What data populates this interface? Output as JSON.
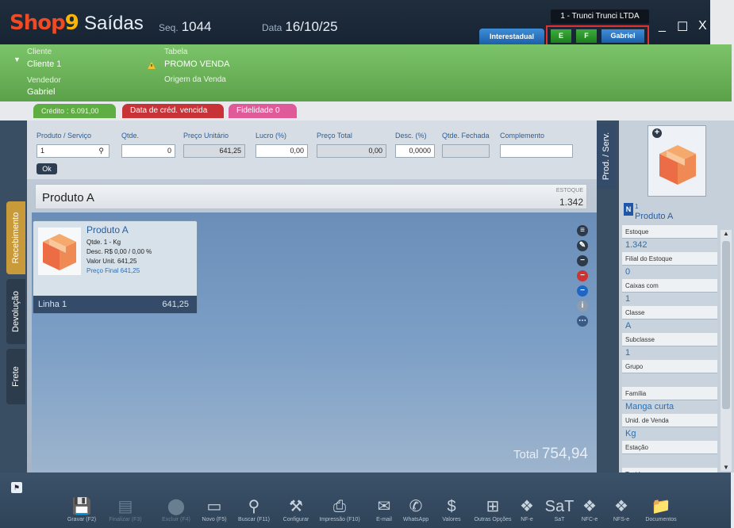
{
  "app": {
    "logo_text": "Shop9",
    "title": "Saídas",
    "seq_label": "Seq.",
    "seq_value": "1044",
    "date_label": "Data",
    "date_value": "16/10/25",
    "company": "1 - Trunci Trunci LTDA",
    "btn_interestadual": "Interestadual",
    "btn_e": "E",
    "btn_f": "F",
    "btn_gabriel": "Gabriel",
    "min": "_",
    "max": "☐",
    "close": "X"
  },
  "header": {
    "cliente_label": "Cliente",
    "cliente_value": "Cliente 1",
    "vendedor_label": "Vendedor",
    "vendedor_value": "Gabriel",
    "tabela_label": "Tabela",
    "tabela_value": "PROMO VENDA",
    "origem_label": "Origem da Venda"
  },
  "badges": {
    "credito_label": "Crédito",
    "credito_value": "6.091,00",
    "vencida": "Data de créd. vencida",
    "fidelidade_label": "Fidelidade",
    "fidelidade_value": "0"
  },
  "side_tabs": [
    "Recebimento",
    "Devolução",
    "Frete"
  ],
  "form": {
    "labels": {
      "produto": "Produto / Serviço",
      "qtde": "Qtde.",
      "preco_unit": "Preço Unitário",
      "lucro": "Lucro (%)",
      "preco_total": "Preço Total",
      "desc": "Desc. (%)",
      "qtde_fechada": "Qtde. Fechada",
      "complemento": "Complemento"
    },
    "values": {
      "produto": "1",
      "qtde": "0",
      "preco_unit": "641,25",
      "lucro": "0,00",
      "preco_total": "0,00",
      "desc": "0,0000",
      "qtde_fechada": "",
      "complemento": ""
    },
    "ok": "Ok"
  },
  "product_bar": {
    "name": "Produto A",
    "estoque_label": "ESTOQUE",
    "estoque_value": "1.342"
  },
  "item_card": {
    "title": "Produto A",
    "qtde": "Qtde.  1 - Kg",
    "desc": "Desc.  R$ 0,00 / 0,00 %",
    "valor_unit": "Valor Unit.  641,25",
    "preco_final": "Preço Final  641,25",
    "linha": "Linha 1",
    "linha_total": "641,25"
  },
  "prod_serv_tab": "Prod. / Serv.",
  "total": {
    "label": "Total",
    "value": "754,94"
  },
  "details": {
    "n_badge": "N",
    "code": "1",
    "product": "Produto A",
    "rows": [
      {
        "label": "Estoque",
        "value": "1.342"
      },
      {
        "label": "Filial do Estoque",
        "value": "0"
      },
      {
        "label": "Caixas com",
        "value": "1"
      },
      {
        "label": "Classe",
        "value": "A"
      },
      {
        "label": "Subclasse",
        "value": "1"
      },
      {
        "label": "Grupo",
        "value": ""
      },
      {
        "label": "Família",
        "value": "Manga curta"
      },
      {
        "label": "Unid. de Venda",
        "value": "Kg"
      },
      {
        "label": "Estação",
        "value": ""
      },
      {
        "label": "Tecido",
        "value": ""
      }
    ]
  },
  "toolbar": [
    {
      "label": "Gravar (F2)",
      "icon": "save-icon",
      "enabled": true
    },
    {
      "label": "Finalizar (F3)",
      "icon": "register-icon",
      "enabled": false
    },
    {
      "label": "Excluir (F4)",
      "icon": "delete-icon",
      "enabled": false
    },
    {
      "label": "Novo (F5)",
      "icon": "eraser-icon",
      "enabled": true
    },
    {
      "label": "Buscar (F11)",
      "icon": "search-icon",
      "enabled": true
    },
    {
      "label": "Configurar",
      "icon": "wrench-icon",
      "enabled": true
    },
    {
      "label": "Impressão (F10)",
      "icon": "printer-icon",
      "enabled": true
    },
    {
      "label": "E-mail",
      "icon": "mail-icon",
      "enabled": true
    },
    {
      "label": "WhatsApp",
      "icon": "whatsapp-icon",
      "enabled": true
    },
    {
      "label": "Valores",
      "icon": "dollar-icon",
      "enabled": true
    },
    {
      "label": "Outras Opções",
      "icon": "more-options-icon",
      "enabled": true
    },
    {
      "label": "NF-e",
      "icon": "nfe-icon",
      "enabled": true
    },
    {
      "label": "SaT",
      "icon": "sat-icon",
      "enabled": true
    },
    {
      "label": "NFC-e",
      "icon": "nfce-icon",
      "enabled": true
    },
    {
      "label": "NFS-e",
      "icon": "nfse-icon",
      "enabled": true
    },
    {
      "label": "Documentos",
      "icon": "folder-icon",
      "enabled": true
    }
  ],
  "colors": {
    "title_bar": "#1f2d3d",
    "green_header": "#6db45b",
    "accent_blue": "#2b6fb3",
    "credit_green": "#5fae43",
    "overdue_red": "#c83338",
    "loyalty_pink": "#e05a9a"
  }
}
